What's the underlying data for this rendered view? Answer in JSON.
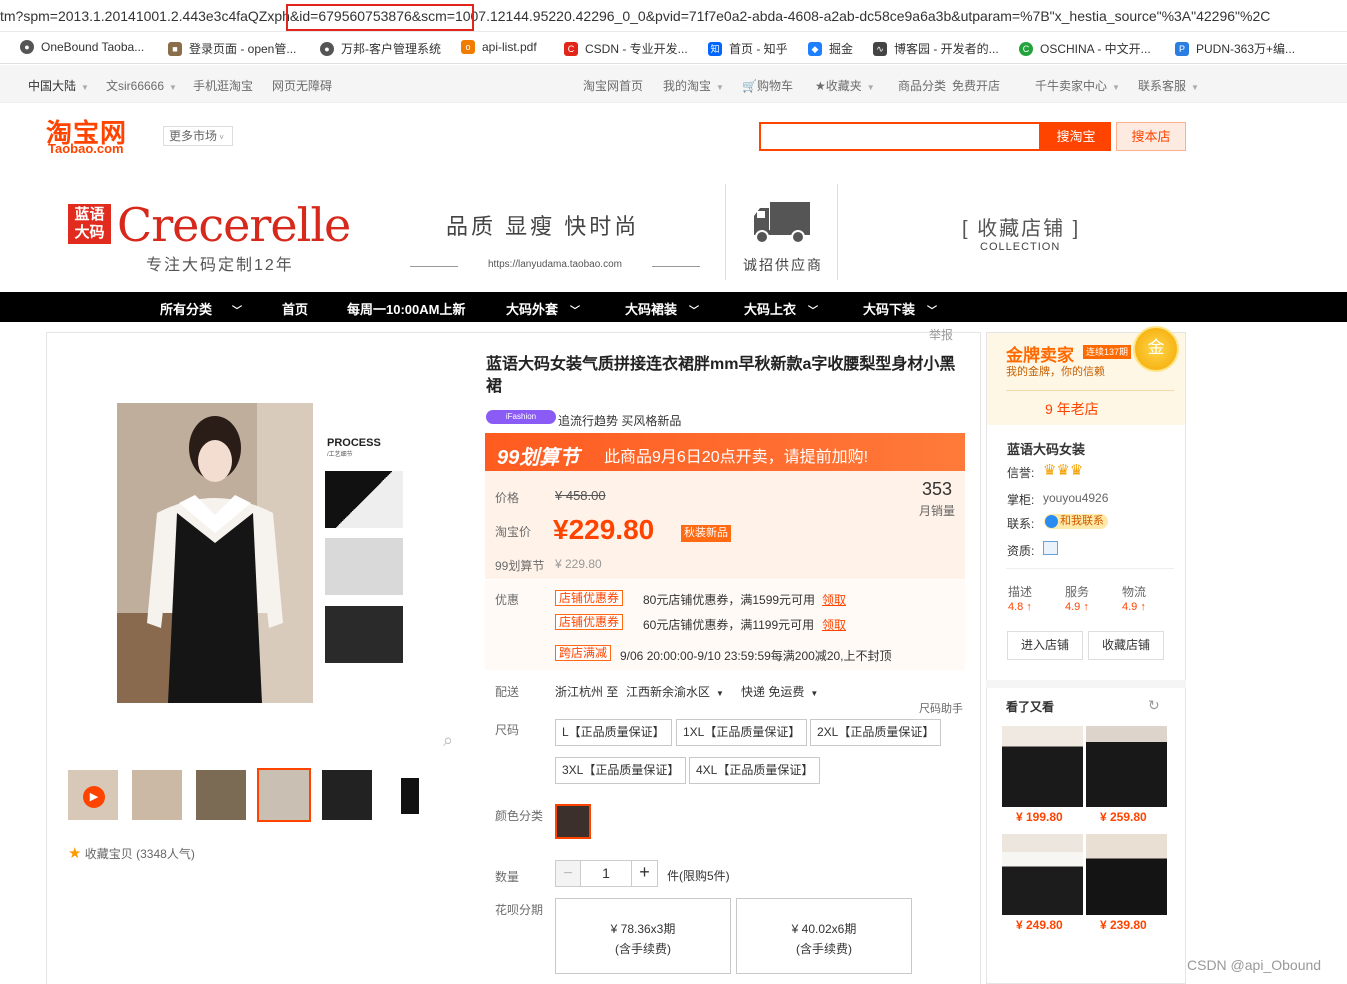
{
  "browser": {
    "url": "tm?spm=2013.1.20141001.2.443e3c4faQZxph&id=679560753876&scm=1007.12144.95220.42296_0_0&pvid=71f7e0a2-abda-4608-a2ab-dc58ce9a6a3b&utparam=%7B\"x_hestia_source\"%3A\"42296\"%2C",
    "bookmarks": [
      "OneBound Taoba...",
      "登录页面 - open管...",
      "万邦-客户管理系统",
      "api-list.pdf",
      "CSDN - 专业开发...",
      "首页 - 知乎",
      "掘金",
      "博客园 - 开发者的...",
      "OSCHINA - 中文开...",
      "PUDN-363万+编..."
    ]
  },
  "topnav": {
    "region": "中国大陆",
    "user": "文sir66666",
    "mobile": "手机逛淘宝",
    "accessible": "网页无障碍",
    "home": "淘宝网首页",
    "my": "我的淘宝",
    "cart": "购物车",
    "favorites": "收藏夹",
    "categories": "商品分类",
    "open_shop": "免费开店",
    "seller": "千牛卖家中心",
    "service": "联系客服"
  },
  "header": {
    "logo_cn": "淘宝网",
    "logo_en": "Taobao.com",
    "more_market": "更多市场",
    "search_btn": "搜淘宝",
    "store_search_btn": "搜本店"
  },
  "banner": {
    "brand_cn": "蓝语大码",
    "brand_en": "Crecerelle",
    "brand_sub": "专注大码定制12年",
    "slogan": "品质 显瘦 快时尚",
    "url": "https://lanyudama.taobao.com",
    "supply": "诚招供应商",
    "collect_cn": "[ 收藏店铺 ]",
    "collect_en": "COLLECTION"
  },
  "catnav": [
    "所有分类",
    "首页",
    "每周一10:00AM上新",
    "大码外套",
    "大码裙装",
    "大码上衣",
    "大码下装"
  ],
  "product": {
    "report": "举报",
    "title": "蓝语大码女装气质拼接连衣裙胖mm早秋新款a字收腰梨型身材小黑裙",
    "tag_badge": "iFashion",
    "tag_text": "追流行趋势 买风格新品",
    "promo_logo": "99划算节",
    "promo_text": "此商品9月6日20点开卖，请提前加购!",
    "price_label": "价格",
    "orig_price": "¥ 458.00",
    "monthly_num": "353",
    "monthly_label": "月销量",
    "now_label": "淘宝价",
    "now_price": "¥229.80",
    "new_badge": "秋装新品",
    "festival_label": "99划算节",
    "festival_price": "¥ 229.80",
    "coupon_label": "优惠",
    "coupons": [
      {
        "tag": "店铺优惠券",
        "text": "80元店铺优惠券，满1599元可用",
        "link": "领取"
      },
      {
        "tag": "店铺优惠券",
        "text": "60元店铺优惠券，满1199元可用",
        "link": "领取"
      },
      {
        "tag": "跨店满减",
        "text": "9/06 20:00:00-9/10 23:59:59每满200减20,上不封顶",
        "link": ""
      }
    ],
    "delivery_label": "配送",
    "delivery_from": "浙江杭州 至",
    "delivery_to": "江西新余渝水区",
    "delivery_method": "快递 免运费",
    "size_helper": "尺码助手",
    "size_label": "尺码",
    "sizes": [
      "L【正品质量保证】",
      "1XL【正品质量保证】",
      "2XL【正品质量保证】",
      "3XL【正品质量保证】",
      "4XL【正品质量保证】"
    ],
    "color_label": "颜色分类",
    "qty_label": "数量",
    "qty_value": "1",
    "qty_limit": "件(限购5件)",
    "installment_label": "花呗分期",
    "installments": [
      {
        "line1": "¥ 78.36x3期",
        "line2": "(含手续费)"
      },
      {
        "line1": "¥ 40.02x6期",
        "line2": "(含手续费)"
      }
    ],
    "process_title": "PROCESS",
    "process_sub": "/工艺细节",
    "favorite": "收藏宝贝 (3348人气)"
  },
  "shop": {
    "gold_title": "金牌卖家",
    "gold_years": "连续137期",
    "gold_sub": "我的金牌，你的信赖",
    "medal": "金",
    "old_shop": "9 年老店",
    "name": "蓝语大码女装",
    "credit_label": "信誉:",
    "keeper_label": "掌柜:",
    "keeper": "youyou4926",
    "contact_label": "联系:",
    "contact_btn": "和我联系",
    "qual_label": "资质:",
    "ratings": [
      {
        "name": "描述",
        "value": "4.8 ↑"
      },
      {
        "name": "服务",
        "value": "4.9 ↑"
      },
      {
        "name": "物流",
        "value": "4.9 ↑"
      }
    ],
    "enter_btn": "进入店铺",
    "collect_btn": "收藏店铺"
  },
  "also_viewed": {
    "title": "看了又看",
    "items": [
      "¥ 199.80",
      "¥ 259.80",
      "¥ 249.80",
      "¥ 239.80"
    ]
  },
  "watermark": "CSDN @api_Obound",
  "colors": {
    "accent": "#ff4400",
    "nav_bg": "#000000",
    "highlight": "#e1251b"
  }
}
